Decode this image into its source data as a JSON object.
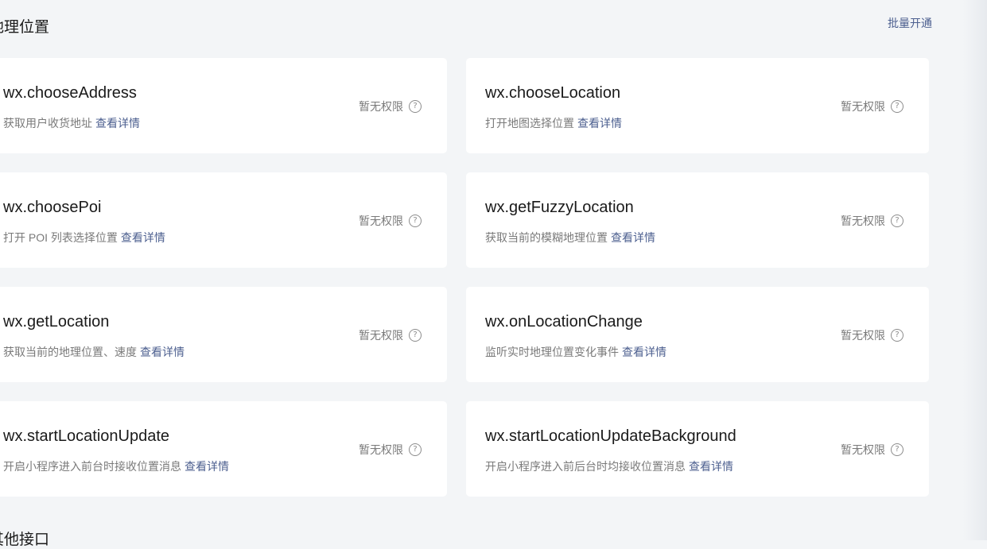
{
  "section": {
    "title": "地理位置",
    "batch_label": "批量开通"
  },
  "next_section": {
    "title": "其他接口"
  },
  "cards": [
    {
      "name": "wx.chooseAddress",
      "desc": "获取用户收货地址",
      "link": "查看详情",
      "perm": "暂无权限"
    },
    {
      "name": "wx.chooseLocation",
      "desc": "打开地图选择位置",
      "link": "查看详情",
      "perm": "暂无权限"
    },
    {
      "name": "wx.choosePoi",
      "desc": "打开 POI 列表选择位置",
      "link": "查看详情",
      "perm": "暂无权限"
    },
    {
      "name": "wx.getFuzzyLocation",
      "desc": "获取当前的模糊地理位置",
      "link": "查看详情",
      "perm": "暂无权限"
    },
    {
      "name": "wx.getLocation",
      "desc": "获取当前的地理位置、速度",
      "link": "查看详情",
      "perm": "暂无权限"
    },
    {
      "name": "wx.onLocationChange",
      "desc": "监听实时地理位置变化事件",
      "link": "查看详情",
      "perm": "暂无权限"
    },
    {
      "name": "wx.startLocationUpdate",
      "desc": "开启小程序进入前台时接收位置消息",
      "link": "查看详情",
      "perm": "暂无权限"
    },
    {
      "name": "wx.startLocationUpdateBackground",
      "desc": "开启小程序进入前后台时均接收位置消息",
      "link": "查看详情",
      "perm": "暂无权限"
    }
  ],
  "icons": {
    "help": "question-circle-icon"
  }
}
